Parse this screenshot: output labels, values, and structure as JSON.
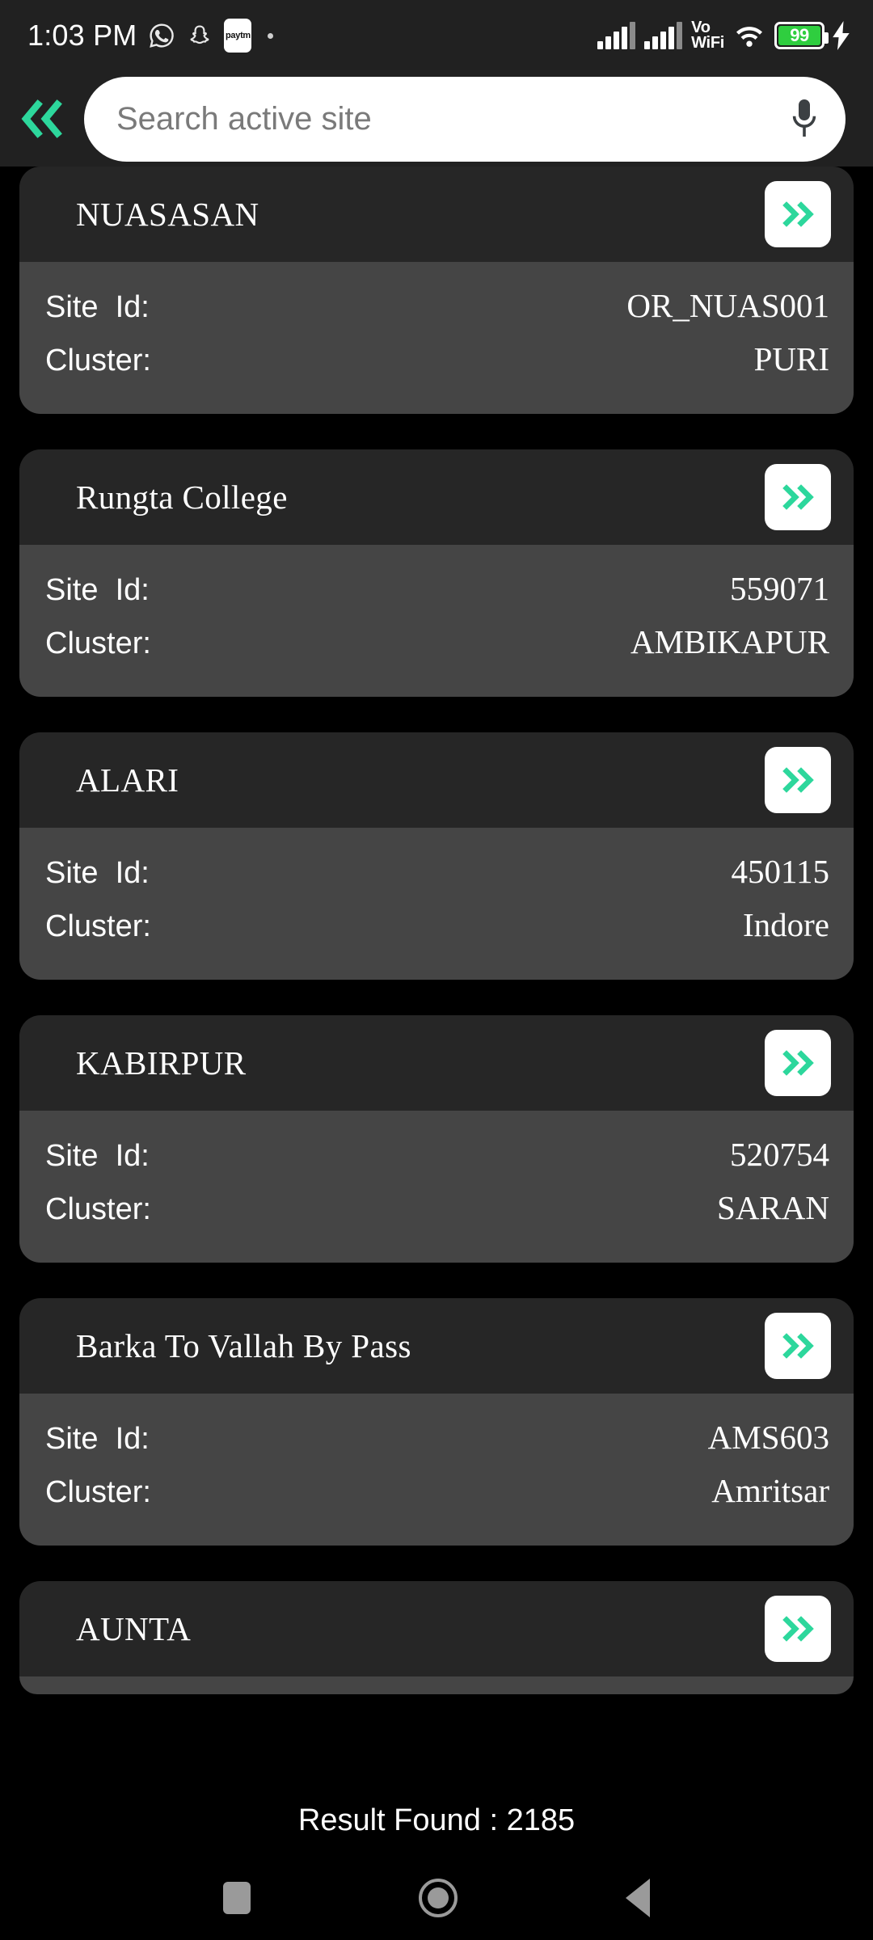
{
  "status_bar": {
    "time": "1:03 PM",
    "icons": [
      "whatsapp-icon",
      "snapchat-icon",
      "paytm-icon",
      "dot-icon"
    ],
    "paytm_label": "paytm",
    "network_label": "Vo\nWiFi",
    "vo_text": "Vo",
    "wifi_text": "WiFi",
    "battery_percent": "99",
    "charging": true
  },
  "top_bar": {
    "back_label": "«",
    "search": {
      "value": "",
      "placeholder": "Search active site"
    },
    "mic_label": "mic-icon"
  },
  "labels": {
    "site_id": "Site  Id:",
    "cluster": "Cluster:"
  },
  "cards": [
    {
      "title": "NUASASAN",
      "site_id": "OR_NUAS001",
      "cluster": "PURI"
    },
    {
      "title": "Rungta College",
      "site_id": "559071",
      "cluster": "AMBIKAPUR"
    },
    {
      "title": "ALARI",
      "site_id": "450115",
      "cluster": "Indore"
    },
    {
      "title": "KABIRPUR",
      "site_id": "520754",
      "cluster": "SARAN"
    },
    {
      "title": "Barka To Vallah By Pass",
      "site_id": "AMS603",
      "cluster": "Amritsar"
    },
    {
      "title": "AUNTA",
      "site_id": "",
      "cluster": ""
    }
  ],
  "footer": {
    "result_text": "Result Found : 2185"
  },
  "nav_bar": {
    "recents": "recents-button",
    "home": "home-button",
    "back": "back-button"
  },
  "colors": {
    "accent": "#2DD79C",
    "page_bg": "#000000",
    "bar_bg": "#212121",
    "card_head_bg": "#262626",
    "card_body_bg": "#454545",
    "battery_green": "#2FCE3F"
  }
}
